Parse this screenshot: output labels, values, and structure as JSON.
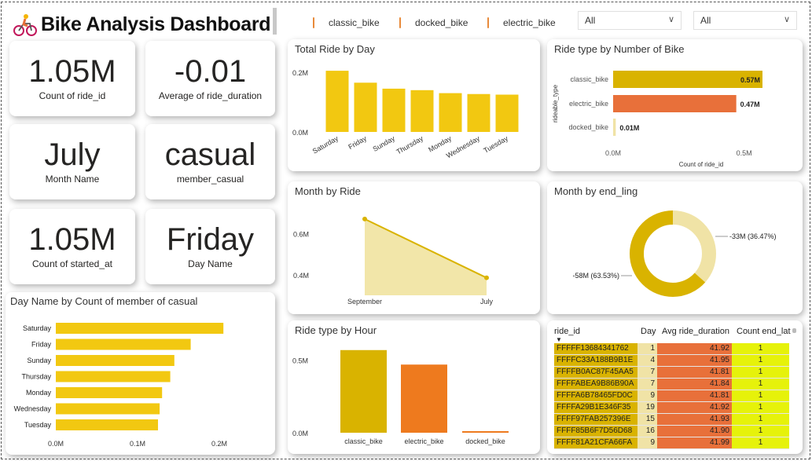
{
  "header": {
    "title": "Bike Analysis Dashboard",
    "legend": [
      "classic_bike",
      "docked_bike",
      "electric_bike"
    ],
    "slicer1": "All",
    "slicer2": "All"
  },
  "kpis": [
    {
      "value": "1.05M",
      "label": "Count of ride_id"
    },
    {
      "value": "-0.01",
      "label": "Average of ride_duration"
    },
    {
      "value": "July",
      "label": "Month Name"
    },
    {
      "value": "casual",
      "label": "member_casual"
    },
    {
      "value": "1.05M",
      "label": "Count of started_at"
    },
    {
      "value": "Friday",
      "label": "Day Name"
    }
  ],
  "colors": {
    "yellow": "#f2c811",
    "gold": "#d9b300",
    "orange": "#e8703a",
    "orange2": "#ee7a1e",
    "lightyellow": "#f0e29a",
    "lime": "#e6f20a",
    "tan": "#f0e3a6"
  },
  "chart_data": [
    {
      "id": "total_ride_by_day",
      "type": "bar",
      "title": "Total Ride by Day",
      "categories": [
        "Saturday",
        "Friday",
        "Sunday",
        "Thursday",
        "Monday",
        "Wednesday",
        "Tuesday"
      ],
      "values": [
        0.205,
        0.165,
        0.145,
        0.14,
        0.13,
        0.127,
        0.125
      ],
      "yticks": [
        "0.0M",
        "0.2M"
      ],
      "ylim": [
        0,
        0.25
      ]
    },
    {
      "id": "ride_type_by_number",
      "type": "bar",
      "title": "Ride type by Number of Bike",
      "orientation": "horizontal",
      "categories": [
        "classic_bike",
        "electric_bike",
        "docked_bike"
      ],
      "values": [
        0.57,
        0.47,
        0.01
      ],
      "labels": [
        "0.57M",
        "0.47M",
        "0.01M"
      ],
      "ylabel": "rideable_type",
      "xlabel": "Count of ride_id",
      "xticks": [
        "0.0M",
        "0.5M"
      ],
      "xlim": [
        0,
        0.6
      ]
    },
    {
      "id": "month_by_ride",
      "type": "area",
      "title": "Month by Ride",
      "categories": [
        "September",
        "July"
      ],
      "values": [
        0.67,
        0.385
      ],
      "yticks": [
        "0.4M",
        "0.6M"
      ],
      "ylim": [
        0.3,
        0.7
      ]
    },
    {
      "id": "month_by_end_ling",
      "type": "pie",
      "title": "Month by end_ling",
      "slices": [
        {
          "label": "-33M (36.47%)",
          "value": 36.47
        },
        {
          "label": "-58M (63.53%)",
          "value": 63.53
        }
      ]
    },
    {
      "id": "day_name_casual",
      "type": "bar",
      "orientation": "horizontal",
      "title": "Day Name by Count of member of casual",
      "categories": [
        "Saturday",
        "Friday",
        "Sunday",
        "Thursday",
        "Monday",
        "Wednesday",
        "Tuesday"
      ],
      "values": [
        0.205,
        0.165,
        0.145,
        0.14,
        0.13,
        0.127,
        0.125
      ],
      "xticks": [
        "0.0M",
        "0.1M",
        "0.2M"
      ],
      "xlim": [
        0,
        0.25
      ]
    },
    {
      "id": "ride_type_by_hour",
      "type": "bar",
      "title": "Ride type by Hour",
      "categories": [
        "classic_bike",
        "electric_bike",
        "docked_bike"
      ],
      "values": [
        0.57,
        0.47,
        0.01
      ],
      "yticks": [
        "0.0M",
        "0.5M"
      ],
      "ylim": [
        0,
        0.65
      ]
    },
    {
      "id": "ride_table",
      "type": "table",
      "columns": [
        "ride_id",
        "Day",
        "Avg ride_duration",
        "Count end_lat"
      ],
      "rows": [
        [
          "FFFFF13684341762",
          "1",
          "41.92",
          "1"
        ],
        [
          "FFFFC33A188B9B1E",
          "4",
          "41.95",
          "1"
        ],
        [
          "FFFFB0AC87F45AA5",
          "7",
          "41.81",
          "1"
        ],
        [
          "FFFFABEA9B86B90A",
          "7",
          "41.84",
          "1"
        ],
        [
          "FFFFA6B78465FD0C",
          "9",
          "41.81",
          "1"
        ],
        [
          "FFFFA29B1E346F35",
          "19",
          "41.92",
          "1"
        ],
        [
          "FFFF97FAB257396E",
          "15",
          "41.93",
          "1"
        ],
        [
          "FFFF85B6F7D56D68",
          "16",
          "41.90",
          "1"
        ],
        [
          "FFFF81A21CFA66FA",
          "9",
          "41.99",
          "1"
        ]
      ]
    }
  ]
}
